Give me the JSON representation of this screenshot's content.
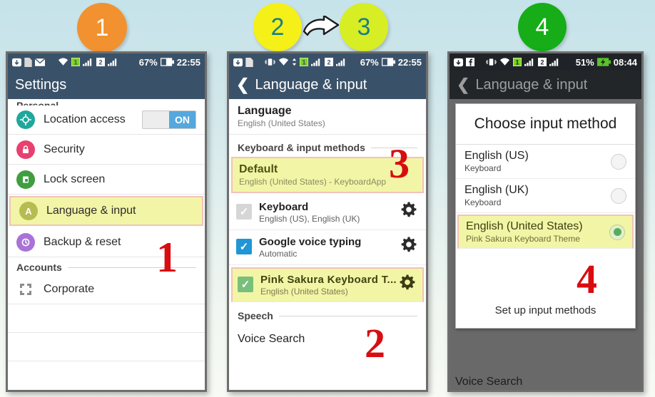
{
  "steps": [
    {
      "label": "1",
      "color": "#f2912f"
    },
    {
      "label": "2",
      "color": "#f5f018"
    },
    {
      "label": "3",
      "color": "#d8ee24"
    },
    {
      "label": "4",
      "color": "#16ad18"
    }
  ],
  "arrow_icon": "right-arrow-icon",
  "phone1": {
    "status": {
      "icons": [
        "download-icon",
        "sd-card-icon",
        "mail-icon",
        "wifi-icon",
        "sim1-icon",
        "signal1-icon",
        "sim2-icon",
        "signal2-icon"
      ],
      "battery_percent": "67%",
      "battery_icon": "battery-icon",
      "time": "22:55"
    },
    "appbar_title": "Settings",
    "cut_section_label": "Personal",
    "rows": [
      {
        "label": "Location access",
        "icon": "location-icon",
        "color": "#1fa89b",
        "glyph": "✲",
        "toggle": "ON"
      },
      {
        "label": "Security",
        "icon": "lock-icon",
        "color": "#e8406f",
        "glyph": "●"
      },
      {
        "label": "Lock screen",
        "icon": "lock-screen-icon",
        "color": "#3f9e3f",
        "glyph": "■"
      },
      {
        "label": "Language & input",
        "icon": "language-icon",
        "color": "#b6bc52",
        "glyph": "A",
        "highlighted": true
      },
      {
        "label": "Backup & reset",
        "icon": "backup-icon",
        "color": "#a972d6",
        "glyph": "↺"
      }
    ],
    "accounts_label": "Accounts",
    "account_row": {
      "label": "Corporate",
      "icon": "corporate-icon"
    },
    "annotation": "1"
  },
  "phone2": {
    "status": {
      "icons": [
        "download-icon",
        "document-icon",
        "vibrate-icon",
        "wifi-icon",
        "sync-icon",
        "sim1-icon",
        "signal1-icon",
        "sim2-icon",
        "signal2-icon"
      ],
      "battery_percent": "67%",
      "battery_icon": "battery-icon",
      "time": "22:55"
    },
    "appbar_title": "Language & input",
    "back_icon": "back-chevron-icon",
    "language": {
      "title": "Language",
      "sub": "English (United States)"
    },
    "section_label": "Keyboard & input methods",
    "default_item": {
      "title": "Default",
      "sub": "English (United States) - KeyboardApp"
    },
    "keyboards": [
      {
        "title": "Keyboard",
        "sub": "English (US), English (UK)",
        "checked": "grey",
        "gear": "gear-icon"
      },
      {
        "title": "Google voice typing",
        "sub": "Automatic",
        "checked": "blue",
        "gear": "gear-icon"
      },
      {
        "title": "Pink Sakura Keyboard T...",
        "sub": "English (United States)",
        "checked": "green",
        "gear": "gear-icon",
        "highlighted": true
      }
    ],
    "speech_label": "Speech",
    "voice_search_label": "Voice Search",
    "annotation_3": "3",
    "annotation_2": "2"
  },
  "phone3": {
    "status": {
      "icons": [
        "download-icon",
        "facebook-icon",
        "vibrate-icon",
        "wifi-icon",
        "sim1-icon",
        "signal1-icon",
        "sim2-icon",
        "signal2-icon"
      ],
      "battery_percent": "51%",
      "battery_icon": "battery-charging-icon",
      "time": "08:44"
    },
    "appbar_title": "Language & input",
    "back_icon": "back-chevron-icon",
    "dialog": {
      "title": "Choose input method",
      "options": [
        {
          "main": "English (US)",
          "sub": "Keyboard",
          "selected": false
        },
        {
          "main": "English (UK)",
          "sub": "Keyboard",
          "selected": false
        },
        {
          "main": "English (United States)",
          "sub": "Pink Sakura Keyboard Theme",
          "selected": true
        }
      ],
      "footer": "Set up input methods"
    },
    "voice_search_label": "Voice Search",
    "annotation": "4"
  }
}
